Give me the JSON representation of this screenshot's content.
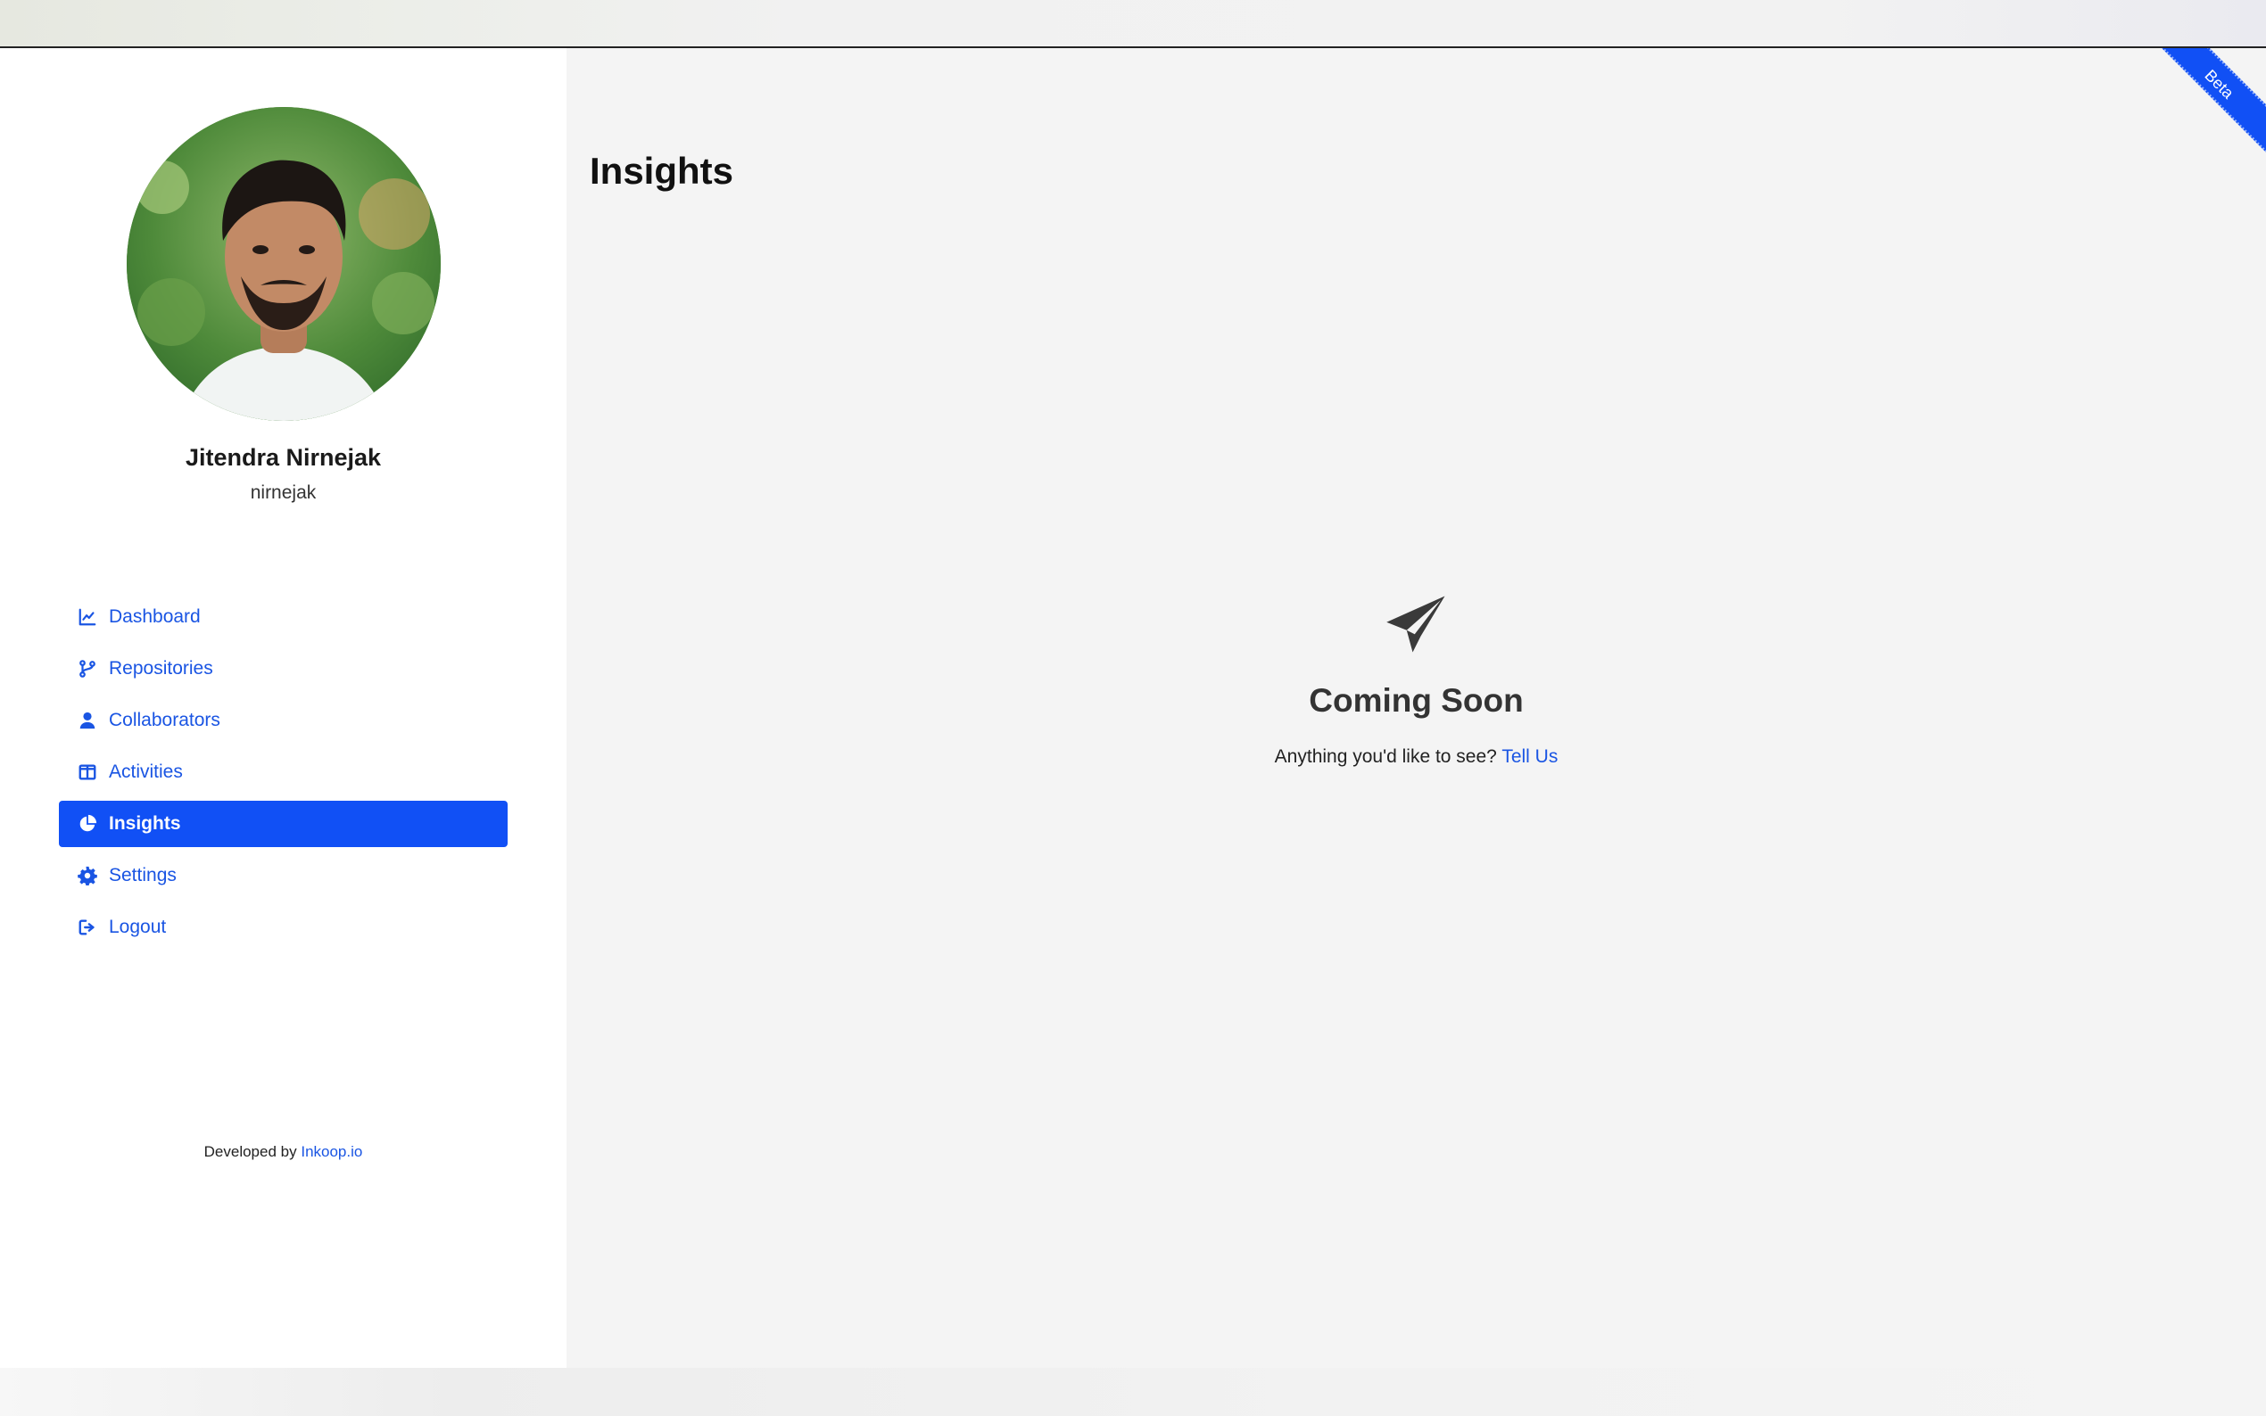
{
  "user": {
    "name": "Jitendra Nirnejak",
    "handle": "nirnejak"
  },
  "sidebar": {
    "items": [
      {
        "label": "Dashboard",
        "icon": "chart-line-icon"
      },
      {
        "label": "Repositories",
        "icon": "branch-icon"
      },
      {
        "label": "Collaborators",
        "icon": "user-icon"
      },
      {
        "label": "Activities",
        "icon": "columns-icon"
      },
      {
        "label": "Insights",
        "icon": "pie-chart-icon",
        "active": true
      },
      {
        "label": "Settings",
        "icon": "gear-icon"
      },
      {
        "label": "Logout",
        "icon": "logout-icon"
      }
    ],
    "credit_prefix": "Developed by",
    "credit_link": "Inkoop.io"
  },
  "main": {
    "title": "Insights",
    "empty": {
      "icon": "paper-plane-icon",
      "title": "Coming Soon",
      "text": "Anything you'd like to see?",
      "link": "Tell Us"
    }
  },
  "ribbon": {
    "label": "Beta"
  },
  "colors": {
    "accent": "#1150f5",
    "link": "#1a55e3",
    "sidebar_bg": "#ffffff",
    "main_bg": "#f4f4f4"
  }
}
